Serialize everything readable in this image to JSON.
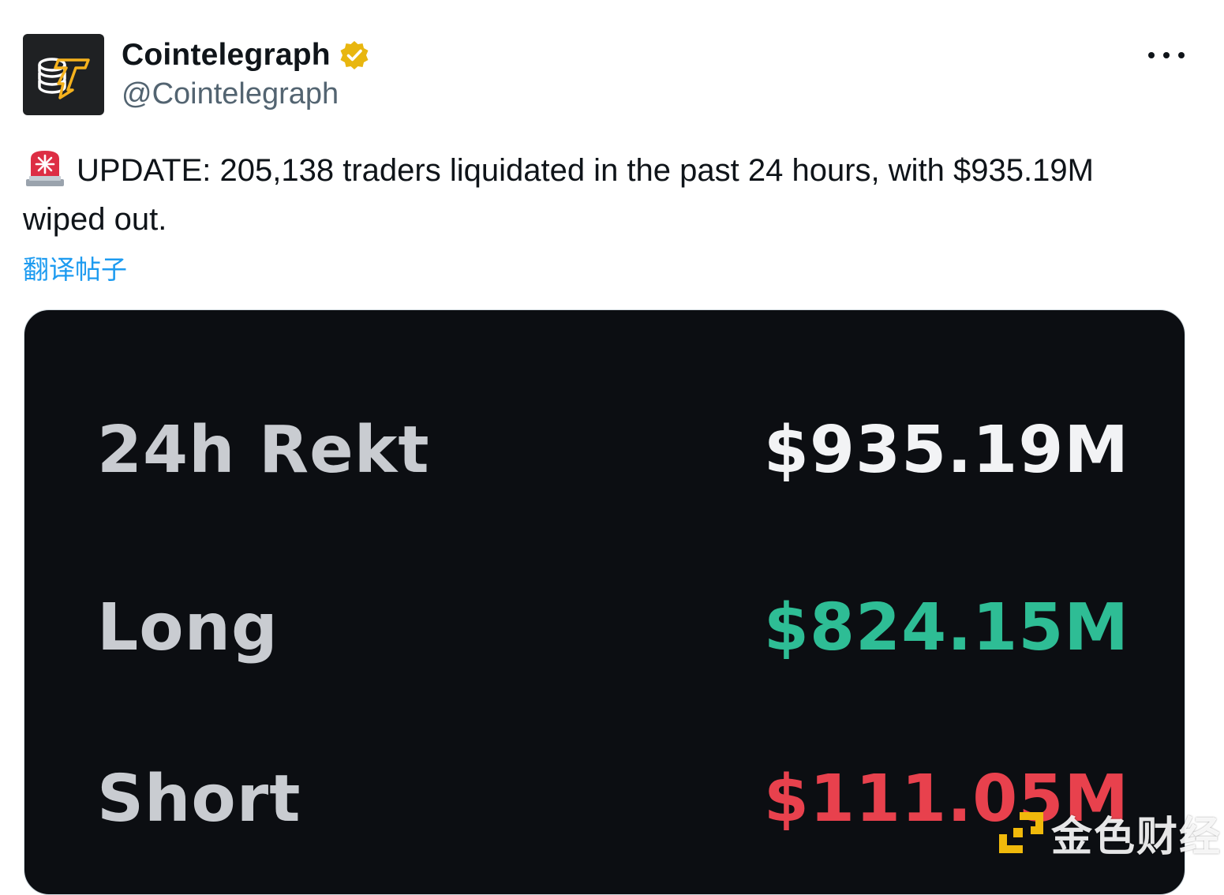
{
  "author": {
    "display_name": "Cointelegraph",
    "handle": "@Cointelegraph",
    "verified_badge_color": "#e8b60f",
    "avatar_bg": "#1f2123",
    "avatar_accent": "#f5b21d"
  },
  "tweet": {
    "emoji": "siren-icon",
    "text": "UPDATE: 205,138 traders liquidated in the past 24 hours, with $935.19M wiped out.",
    "translate_label": "翻译帖子"
  },
  "media": {
    "background": "#0c0e12",
    "rows": [
      {
        "label": "24h Rekt",
        "value": "$935.19M",
        "color": "#f2f3f5"
      },
      {
        "label": "Long",
        "value": "$824.15M",
        "color": "#2ebd95"
      },
      {
        "label": "Short",
        "value": "$111.05M",
        "color": "#e8414d"
      }
    ]
  },
  "watermark": {
    "text": "金色财经",
    "logo_color": "#f0b90b"
  }
}
